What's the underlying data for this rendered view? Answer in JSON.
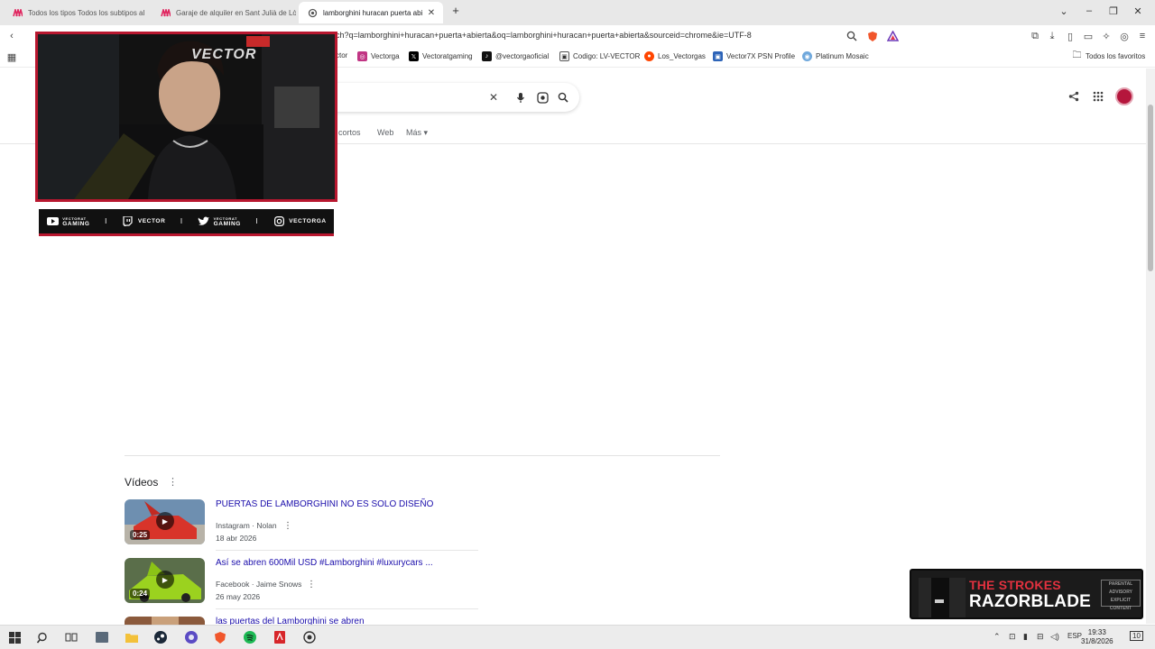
{
  "browser": {
    "tabs": [
      {
        "title": "Todos los tipos Todos los subtipos al",
        "active": false,
        "icon": "game-logo-icon"
      },
      {
        "title": "Garaje de alquiler en Sant Julià de Lò",
        "active": false,
        "icon": "game-logo-icon"
      },
      {
        "title": "lamborghini huracan puerta abi",
        "active": true,
        "icon": "google-loading-icon"
      }
    ],
    "new_tab": "+",
    "url": "ch?q=lamborghini+huracan+puerta+abierta&oq=lamborghini+huracan+puerta+abierta&sourceid=chrome&ie=UTF-8",
    "bookmarks": [
      {
        "label": "ctor",
        "icon": "twitch-icon"
      },
      {
        "label": "Vectorga",
        "icon": "instagram-icon"
      },
      {
        "label": "Vectoratgaming",
        "icon": "x-icon"
      },
      {
        "label": "@vectorgaoficial",
        "icon": "tiktok-icon"
      },
      {
        "label": "Codigo: LV-VECTOR",
        "icon": "code-icon"
      },
      {
        "label": "Los_Vectorgas",
        "icon": "reddit-icon"
      },
      {
        "label": "Vector7X PSN Profile",
        "icon": "psn-icon"
      },
      {
        "label": "Platinum Mosaic",
        "icon": "globe-icon"
      }
    ],
    "all_bookmarks": "Todos los favoritos"
  },
  "google": {
    "nav": [
      {
        "label": "s cortos"
      },
      {
        "label": "Web"
      },
      {
        "label": "Más ▾"
      }
    ]
  },
  "overlay": {
    "cam_logo": "VECTOR",
    "socials": [
      {
        "line1": "VECTORAT",
        "line2": "GAMING",
        "icon": "youtube-icon"
      },
      {
        "line1": "VECTOR",
        "line2": "",
        "icon": "twitch-icon"
      },
      {
        "line1": "VECTORAT",
        "line2": "GAMING",
        "icon": "twitter-icon"
      },
      {
        "line1": "VECTORGA",
        "line2": "",
        "icon": "instagram-icon"
      }
    ]
  },
  "videos": {
    "title": "Vídeos",
    "items": [
      {
        "title": "PUERTAS DE LAMBORGHINI NO ES SOLO DISEÑO",
        "source": "Instagram · Nolan",
        "date": "18 abr 2026",
        "duration": "0:25",
        "thumb_color": "#d8342a"
      },
      {
        "title": "Así se abren 600Mil USD #Lamborghini #luxurycars ...",
        "source": "Facebook · Jaime Snows",
        "date": "26 may 2026",
        "duration": "0:24",
        "thumb_color": "#9bd21f"
      },
      {
        "title": "las puertas del Lamborghini se abren",
        "source": "",
        "date": "",
        "duration": "",
        "thumb_color": "#8b5a3c"
      }
    ]
  },
  "now_playing": {
    "artist": "THE STROKES",
    "song": "RAZORBLADE",
    "advisory": "PARENTAL ADVISORY EXPLICIT CONTENT"
  },
  "taskbar": {
    "lang": "ESP",
    "time": "19:33",
    "date": "31/8/2026",
    "notif_count": "10"
  }
}
